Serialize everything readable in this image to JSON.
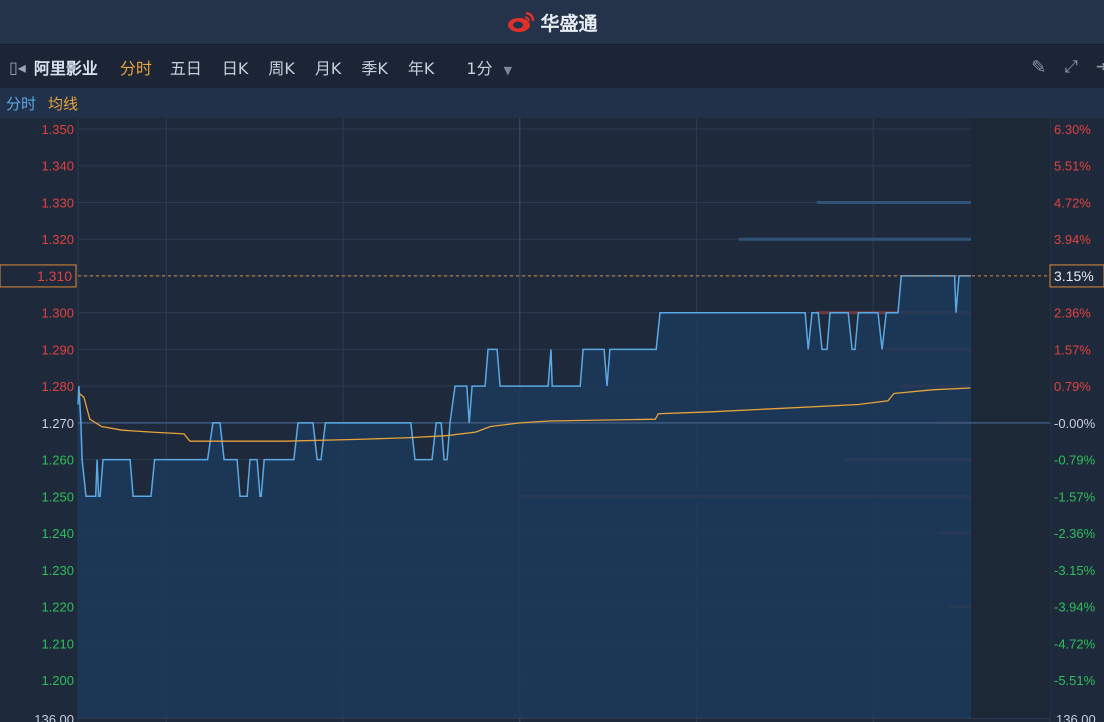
{
  "app": {
    "title": "华盛通",
    "brand_color": "#e0302c"
  },
  "toolbar": {
    "stock_name": "阿里影业",
    "tabs": [
      {
        "label": "分时",
        "active": true
      },
      {
        "label": "五日"
      },
      {
        "label": "日K"
      },
      {
        "label": "周K"
      },
      {
        "label": "月K"
      },
      {
        "label": "季K"
      },
      {
        "label": "年K"
      }
    ],
    "interval": "1分"
  },
  "legend": {
    "price_label": "分时",
    "avg_label": "均线",
    "price_color": "#5aa9e6",
    "avg_color": "#e8a33a"
  },
  "chart_data": {
    "type": "line",
    "ylim": [
      1.195,
      1.352
    ],
    "xlim": [
      0,
      330
    ],
    "prev_close": 1.27,
    "current_price_label": "1.310",
    "current_pct_label": "3.15%",
    "y_ticks": [
      "1.350",
      "1.340",
      "1.330",
      "1.320",
      "1.310",
      "1.300",
      "1.290",
      "1.280",
      "1.270",
      "1.260",
      "1.250",
      "1.240",
      "1.230",
      "1.220",
      "1.210",
      "1.200"
    ],
    "y_tick_values": [
      1.35,
      1.34,
      1.33,
      1.32,
      1.31,
      1.3,
      1.29,
      1.28,
      1.27,
      1.26,
      1.25,
      1.24,
      1.23,
      1.22,
      1.21,
      1.2
    ],
    "pct_ticks": [
      "6.30%",
      "5.51%",
      "4.72%",
      "3.94%",
      "3.15%",
      "2.36%",
      "1.57%",
      "0.79%",
      "-0.00%",
      "-0.79%",
      "-1.57%",
      "-2.36%",
      "-3.15%",
      "-3.94%",
      "-4.72%",
      "-5.51%"
    ],
    "volume_axis_label": "136.00",
    "x_grid_minutes": [
      30,
      90,
      150,
      210,
      270
    ],
    "series": [
      {
        "name": "分时",
        "points": [
          [
            0,
            1.275
          ],
          [
            0.3,
            1.28
          ],
          [
            1,
            1.27
          ],
          [
            1.4,
            1.26
          ],
          [
            2.7,
            1.25
          ],
          [
            6,
            1.25
          ],
          [
            6.5,
            1.26
          ],
          [
            7,
            1.25
          ],
          [
            7.5,
            1.25
          ],
          [
            8.5,
            1.26
          ],
          [
            17.7,
            1.26
          ],
          [
            18.7,
            1.25
          ],
          [
            24.8,
            1.25
          ],
          [
            26,
            1.26
          ],
          [
            44,
            1.26
          ],
          [
            45.8,
            1.27
          ],
          [
            48.2,
            1.27
          ],
          [
            49.6,
            1.26
          ],
          [
            54,
            1.26
          ],
          [
            55,
            1.25
          ],
          [
            57.4,
            1.25
          ],
          [
            58.4,
            1.26
          ],
          [
            60.8,
            1.26
          ],
          [
            61.8,
            1.25
          ],
          [
            62.2,
            1.25
          ],
          [
            63.2,
            1.26
          ],
          [
            73.3,
            1.26
          ],
          [
            74.7,
            1.27
          ],
          [
            79.8,
            1.27
          ],
          [
            81.2,
            1.26
          ],
          [
            82.5,
            1.26
          ],
          [
            84,
            1.27
          ],
          [
            113,
            1.27
          ],
          [
            114.4,
            1.26
          ],
          [
            120.2,
            1.26
          ],
          [
            121.6,
            1.27
          ],
          [
            123.3,
            1.27
          ],
          [
            124.3,
            1.26
          ],
          [
            125.3,
            1.26
          ],
          [
            126.3,
            1.27
          ],
          [
            128,
            1.28
          ],
          [
            132,
            1.28
          ],
          [
            132.8,
            1.27
          ],
          [
            133.8,
            1.28
          ],
          [
            138.2,
            1.28
          ],
          [
            139.2,
            1.29
          ],
          [
            142.3,
            1.29
          ],
          [
            143.3,
            1.28
          ],
          [
            159.6,
            1.28
          ],
          [
            160.6,
            1.29
          ],
          [
            161,
            1.28
          ],
          [
            170.5,
            1.28
          ],
          [
            171.5,
            1.29
          ],
          [
            178.6,
            1.29
          ],
          [
            179.6,
            1.28
          ],
          [
            180.6,
            1.29
          ],
          [
            196.3,
            1.29
          ],
          [
            197.6,
            1.3
          ],
          [
            246.9,
            1.3
          ],
          [
            247.9,
            1.29
          ],
          [
            249.2,
            1.3
          ],
          [
            251.3,
            1.3
          ],
          [
            252.6,
            1.29
          ],
          [
            254.3,
            1.29
          ],
          [
            255.3,
            1.3
          ],
          [
            261.5,
            1.3
          ],
          [
            262.8,
            1.29
          ],
          [
            263.8,
            1.29
          ],
          [
            264.9,
            1.3
          ],
          [
            271.6,
            1.3
          ],
          [
            273,
            1.29
          ],
          [
            274.4,
            1.3
          ],
          [
            278.4,
            1.3
          ],
          [
            279.5,
            1.31
          ],
          [
            297.6,
            1.31
          ],
          [
            298.1,
            1.3
          ],
          [
            299.1,
            1.31
          ],
          [
            303.2,
            1.31
          ]
        ]
      },
      {
        "name": "均线",
        "points": [
          [
            0.5,
            1.278
          ],
          [
            2,
            1.277
          ],
          [
            4,
            1.271
          ],
          [
            8,
            1.269
          ],
          [
            15,
            1.268
          ],
          [
            25,
            1.2675
          ],
          [
            36,
            1.267
          ],
          [
            38,
            1.265
          ],
          [
            70,
            1.265
          ],
          [
            95,
            1.2655
          ],
          [
            113,
            1.266
          ],
          [
            125,
            1.2665
          ],
          [
            135,
            1.2675
          ],
          [
            140,
            1.269
          ],
          [
            150,
            1.27
          ],
          [
            160,
            1.2705
          ],
          [
            196,
            1.271
          ],
          [
            197,
            1.2725
          ],
          [
            215,
            1.273
          ],
          [
            240,
            1.274
          ],
          [
            265,
            1.275
          ],
          [
            275,
            1.276
          ],
          [
            277,
            1.278
          ],
          [
            290,
            1.279
          ],
          [
            303,
            1.2795
          ]
        ]
      }
    ],
    "depth_bars": [
      {
        "price": 1.34,
        "side": "sell",
        "volume": 0.06
      },
      {
        "price": 1.33,
        "side": "sell",
        "volume": 0.24
      },
      {
        "price": 1.32,
        "side": "sell",
        "volume": 0.32
      },
      {
        "price": 1.3,
        "side": "buy",
        "volume": 0.24
      },
      {
        "price": 1.29,
        "side": "buy",
        "volume": 0.17
      },
      {
        "price": 1.28,
        "side": "buy",
        "volume": 0.155
      },
      {
        "price": 1.27,
        "side": "buy",
        "volume": 0.115
      },
      {
        "price": 1.26,
        "side": "buy",
        "volume": 0.21
      },
      {
        "price": 1.25,
        "side": "buy",
        "volume": 0.546
      },
      {
        "price": 1.24,
        "side": "buy",
        "volume": 0.113
      },
      {
        "price": 1.23,
        "side": "buy",
        "volume": 0.036
      },
      {
        "price": 1.22,
        "side": "buy",
        "volume": 0.105
      },
      {
        "price": 1.21,
        "side": "buy",
        "volume": 0.015
      }
    ]
  }
}
